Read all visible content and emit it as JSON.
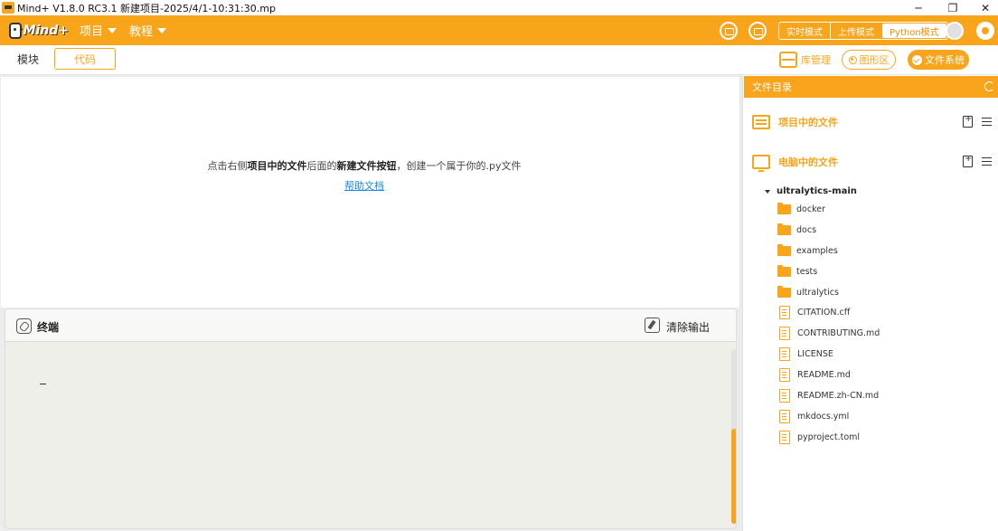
{
  "window": {
    "title": "Mind+ V1.8.0 RC3.1   新建项目-2025/4/1-10:31:30.mp",
    "minimize": "─",
    "restore": "❐",
    "close": "✕"
  },
  "menubar": {
    "logo_text": "Mind+",
    "items": [
      {
        "label": "项目"
      },
      {
        "label": "教程"
      }
    ],
    "modes": [
      "实时模式",
      "上传模式",
      "Python模式"
    ],
    "active_mode": "Python模式"
  },
  "tabs": {
    "blocks": "模块",
    "code": "代码"
  },
  "toolbar": {
    "library": "库管理",
    "stage": "图形区",
    "filesystem": "文件系统"
  },
  "editor": {
    "hint_pre": "点击右侧",
    "hint_bold1": "项目中的文件",
    "hint_mid": "后面的",
    "hint_bold2": "新建文件按钮",
    "hint_post": "，创建一个属于你的.py文件",
    "help_link": "帮助文档"
  },
  "terminal": {
    "title": "终端",
    "clear": "清除输出"
  },
  "panel": {
    "title": "文件目录",
    "sections": [
      {
        "label": "项目中的文件"
      },
      {
        "label": "电脑中的文件"
      }
    ],
    "tree_root": "ultralytics-main",
    "folders": [
      "docker",
      "docs",
      "examples",
      "tests",
      "ultralytics"
    ],
    "files": [
      "CITATION.cff",
      "CONTRIBUTING.md",
      "LICENSE",
      "README.md",
      "README.zh-CN.md",
      "mkdocs.yml",
      "pyproject.toml"
    ]
  },
  "colors": {
    "accent": "#f8a51c",
    "link": "#1e88e5"
  }
}
